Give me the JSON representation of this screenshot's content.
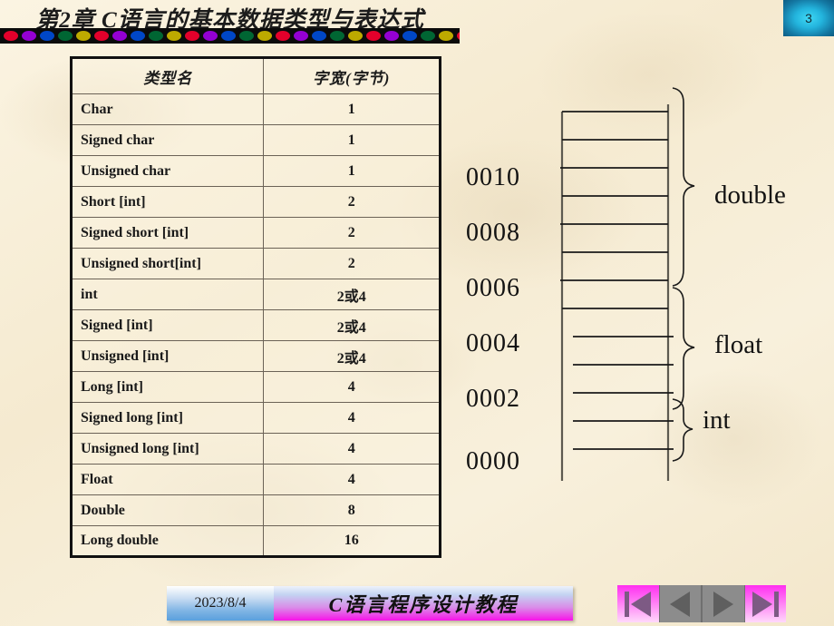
{
  "slide": {
    "title": "第2章 C语言的基本数据类型与表达式",
    "page_number": "3",
    "background_color": "#f7eed8"
  },
  "title_rule": {
    "dot_colors": [
      "#e4002b",
      "#9400d3",
      "#0047c7",
      "#006633",
      "#bdaa00"
    ]
  },
  "table": {
    "headers": [
      "类型名",
      "字宽(字节)"
    ],
    "rows": [
      {
        "name": "Char",
        "width": "1"
      },
      {
        "name": "Signed char",
        "width": "1"
      },
      {
        "name": "Unsigned  char",
        "width": "1"
      },
      {
        "name": "Short [int]",
        "width": "2"
      },
      {
        "name": "Signed short [int]",
        "width": "2"
      },
      {
        "name": "Unsigned  short[int]",
        "width": "2"
      },
      {
        "name": "int",
        "width": "2或4"
      },
      {
        "name": "Signed [int]",
        "width": "2或4"
      },
      {
        "name": "Unsigned  [int]",
        "width": "2或4"
      },
      {
        "name": "Long [int]",
        "width": "4"
      },
      {
        "name": "Signed long  [int]",
        "width": "4"
      },
      {
        "name": "Unsigned  long  [int]",
        "width": "4"
      },
      {
        "name": "Float",
        "width": "4"
      },
      {
        "name": "Double",
        "width": "8"
      },
      {
        "name": "Long double",
        "width": "16"
      }
    ]
  },
  "memory_diagram": {
    "addresses": [
      "0010",
      "0008",
      "0006",
      "0004",
      "0002",
      "0000"
    ],
    "type_labels": [
      "double",
      "float",
      "int"
    ]
  },
  "footer": {
    "date": "2023/8/4",
    "subject": "C语言程序设计教程"
  },
  "nav": {
    "first_label": "first-slide",
    "previous_label": "previous-slide",
    "next_label": "next-slide",
    "last_label": "last-slide"
  }
}
